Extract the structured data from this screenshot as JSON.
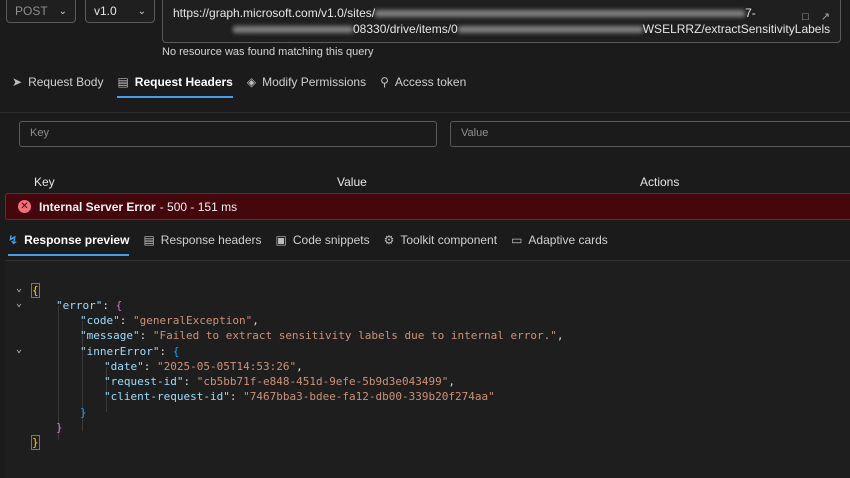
{
  "toolbar": {
    "method": "POST",
    "version": "v1.0",
    "url_line1_start": "https://graph.microsoft.com/v1.0/sites/",
    "url_line1_end": "7-",
    "url_line2_start": "08330/drive/items/0",
    "url_line2_end": "WSELRRZ/extractSensitivityLabels",
    "status_text": "No resource was found matching this query",
    "icons": [
      "document-icon",
      "share-icon"
    ]
  },
  "request_tabs": [
    {
      "label": "Request Body",
      "icon": "send-icon"
    },
    {
      "label": "Request Headers",
      "icon": "document-icon",
      "active": true
    },
    {
      "label": "Modify Permissions",
      "icon": "shield-icon"
    },
    {
      "label": "Access token",
      "icon": "key-icon"
    }
  ],
  "headers_form": {
    "key_placeholder": "Key",
    "value_placeholder": "Value",
    "columns": [
      "Key",
      "Value",
      "Actions"
    ]
  },
  "error": {
    "title": "Internal Server Error",
    "detail": "- 500 - 151 ms"
  },
  "response_tabs": [
    {
      "label": "Response preview",
      "icon": "preview-icon",
      "active": true
    },
    {
      "label": "Response headers",
      "icon": "headers-icon"
    },
    {
      "label": "Code snippets",
      "icon": "code-icon"
    },
    {
      "label": "Toolkit component",
      "icon": "toolkit-icon"
    },
    {
      "label": "Adaptive cards",
      "icon": "card-icon"
    }
  ],
  "response_json": {
    "code": "generalException",
    "message": "Failed to extract sensitivity labels due to internal error.",
    "date": "2025-05-05T14:53:26",
    "request_id": "cb5bb71f-e848-451d-9efe-5b9d3e043499",
    "client_request_id": "7467bba3-bdee-fa12-db00-339b20f274aa"
  },
  "colors": {
    "accent": "#4a9ee8",
    "error_bg": "#44070b",
    "error_icon": "#f1707b",
    "json_key": "#9cdcfe",
    "json_string": "#ce9178"
  }
}
